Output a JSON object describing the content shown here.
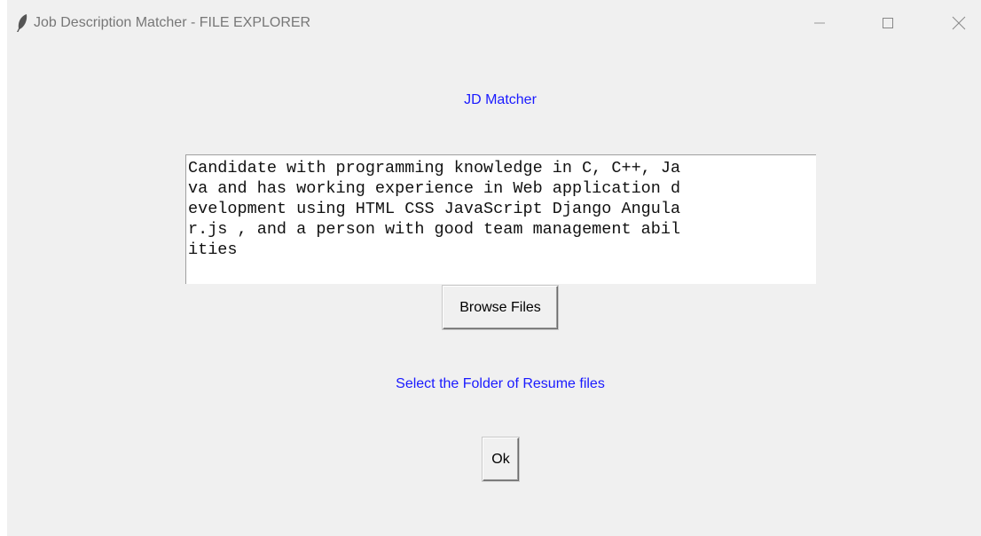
{
  "window": {
    "title": "Job Description Matcher - FILE EXPLORER",
    "app_icon": "feather-icon",
    "controls": {
      "minimize_icon": "minimize-icon",
      "maximize_icon": "maximize-icon",
      "close_icon": "close-icon"
    }
  },
  "main": {
    "heading": "JD Matcher",
    "job_description_lines": [
      "Candidate with programming knowledge in C, C++, Ja",
      "va and has working experience in Web application d",
      "evelopment using HTML CSS JavaScript Django Angula",
      "r.js , and a person with good team management abil",
      "ities"
    ],
    "browse_button_label": "Browse Files",
    "folder_prompt": "Select the Folder of Resume files",
    "ok_button_label": "Ok"
  },
  "colors": {
    "label_blue": "#1a1aff",
    "window_bg": "#f0f0f0",
    "text_area_bg": "#ffffff"
  }
}
